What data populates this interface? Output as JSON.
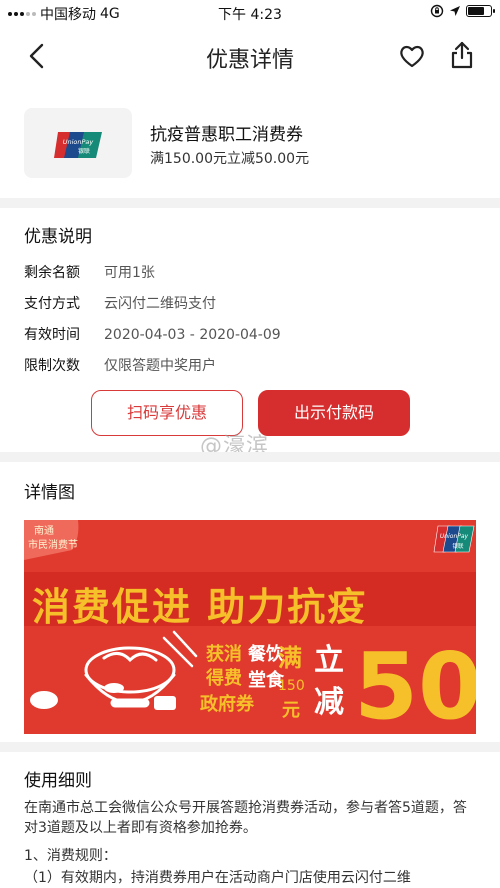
{
  "status_bar": {
    "carrier": "中国移动",
    "network": "4G",
    "time": "下午 4:23",
    "battery_level": 0.8
  },
  "nav": {
    "title": "优惠详情",
    "icons": [
      "back-icon",
      "heart-icon",
      "share-icon"
    ]
  },
  "coupon": {
    "logo_text": "UnionPay",
    "logo_sub": "银联",
    "title": "抗疫普惠职工消费券",
    "subtitle": "满150.00元立减50.00元"
  },
  "offer": {
    "section_title": "优惠说明",
    "rows": [
      {
        "label": "剩余名额",
        "value": "可用1张"
      },
      {
        "label": "支付方式",
        "value": "云闪付二维码支付"
      },
      {
        "label": "有效时间",
        "value": "2020-04-03 - 2020-04-09"
      },
      {
        "label": "限制次数",
        "value": "仅限答题中奖用户"
      }
    ]
  },
  "actions": {
    "scan_label": "扫码享优惠",
    "show_code_label": "出示付款码"
  },
  "watermark": "@濠滨",
  "detail": {
    "section_title": "详情图",
    "banner": {
      "corner_tag_line1": "南通",
      "corner_tag_line2": "市民消费节",
      "headline": "消费促进  助力抗疫",
      "col1_top": "获消",
      "col1_mid": "得费",
      "col1_low": "政府券",
      "col2_top": "餐饮",
      "col2_low": "堂食",
      "big_man": "满",
      "amount_min": "150",
      "yuan": "元",
      "li": "立",
      "jian": "减",
      "amount_off": "50",
      "logo_text": "UnionPay",
      "logo_sub": "银联",
      "colors": {
        "bg": "#e03a2e",
        "gold": "#f6c02a",
        "cream": "#fff3d0"
      }
    }
  },
  "rules": {
    "section_title": "使用细则",
    "paragraph": "在南通市总工会微信公众号开展答题抢消费券活动，参与者答5道题，答对3道题及以上者即有资格参加抢券。",
    "line1": "1、消费规则：",
    "line2": "（1）有效期内，持消费券用户在活动商户门店使用云闪付二维"
  }
}
